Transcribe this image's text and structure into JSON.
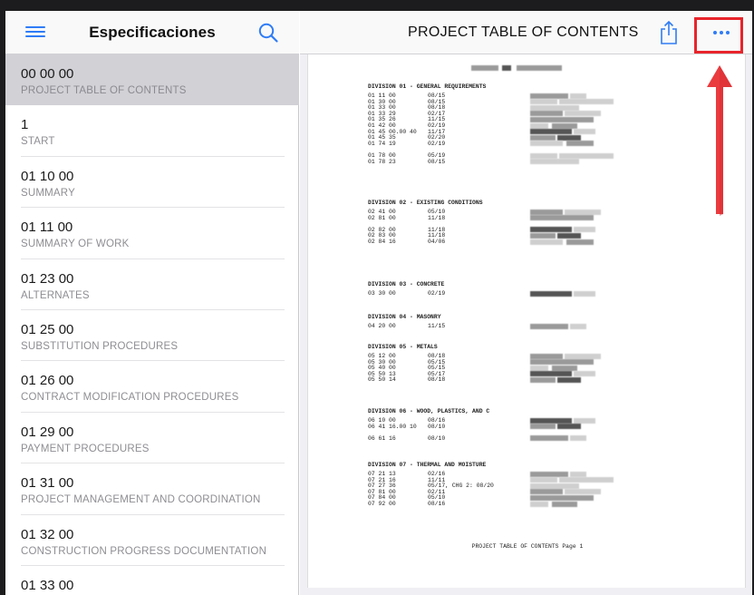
{
  "left_pane": {
    "title": "Especificaciones",
    "items": [
      {
        "num": "00 00 00",
        "title": "PROJECT TABLE OF CONTENTS",
        "selected": true
      },
      {
        "num": "1",
        "title": "Start",
        "selected": false
      },
      {
        "num": "01 10 00",
        "title": "SUMMARY",
        "selected": false
      },
      {
        "num": "01 11 00",
        "title": "SUMMARY OF WORK",
        "selected": false
      },
      {
        "num": "01 23 00",
        "title": "ALTERNATES",
        "selected": false
      },
      {
        "num": "01 25 00",
        "title": "SUBSTITUTION PROCEDURES",
        "selected": false
      },
      {
        "num": "01 26 00",
        "title": "CONTRACT MODIFICATION PROCEDURES",
        "selected": false
      },
      {
        "num": "01 29 00",
        "title": "PAYMENT PROCEDURES",
        "selected": false
      },
      {
        "num": "01 31 00",
        "title": "PROJECT MANAGEMENT AND COORDINATION",
        "selected": false
      },
      {
        "num": "01 32 00",
        "title": "CONSTRUCTION PROGRESS DOCUMENTATION",
        "selected": false
      },
      {
        "num": "01 33 00",
        "title": "",
        "selected": false
      }
    ]
  },
  "right_pane": {
    "title": "PROJECT TABLE OF CONTENTS",
    "accent_color": "#2f7cf6",
    "annotation_color": "#e8242b"
  },
  "document": {
    "divisions": [
      {
        "heading": "DIVISION 01 - GENERAL REQUIREMENTS",
        "rows": [
          {
            "sec": "01 11 00",
            "date": "08/15"
          },
          {
            "sec": "01 30 00",
            "date": "08/15"
          },
          {
            "sec": "01 33 00",
            "date": "08/18"
          },
          {
            "sec": "01 33 29",
            "date": "02/17"
          },
          {
            "sec": "01 35 26",
            "date": "11/15"
          },
          {
            "sec": "01 42 00",
            "date": "02/19"
          },
          {
            "sec": "01 45 00.00 40",
            "date": "11/17"
          },
          {
            "sec": "01 45 35",
            "date": "02/20"
          },
          {
            "sec": "01 74 19",
            "date": "02/19"
          },
          {
            "sec": "",
            "date": ""
          },
          {
            "sec": "01 78 00",
            "date": "05/19"
          },
          {
            "sec": "01 78 23",
            "date": "08/15"
          }
        ]
      },
      {
        "heading": "DIVISION 02 - EXISTING CONDITIONS",
        "rows": [
          {
            "sec": "02 41 00",
            "date": "05/10"
          },
          {
            "sec": "02 81 00",
            "date": "11/18"
          },
          {
            "sec": "",
            "date": ""
          },
          {
            "sec": "02 82 00",
            "date": "11/18"
          },
          {
            "sec": "02 83 00",
            "date": "11/18"
          },
          {
            "sec": "02 84 16",
            "date": "04/06"
          }
        ]
      },
      {
        "heading": "DIVISION 03 - CONCRETE",
        "rows": [
          {
            "sec": "03 30 00",
            "date": "02/19"
          }
        ]
      },
      {
        "heading": "DIVISION 04 - MASONRY",
        "rows": [
          {
            "sec": "04 20 00",
            "date": "11/15"
          }
        ]
      },
      {
        "heading": "DIVISION 05 - METALS",
        "rows": [
          {
            "sec": "05 12 00",
            "date": "08/18"
          },
          {
            "sec": "05 30 00",
            "date": "05/15"
          },
          {
            "sec": "05 40 00",
            "date": "05/15"
          },
          {
            "sec": "05 50 13",
            "date": "05/17"
          },
          {
            "sec": "05 50 14",
            "date": "08/18"
          }
        ]
      },
      {
        "heading": "DIVISION 06 - WOOD, PLASTICS, AND C",
        "rows": [
          {
            "sec": "06 10 00",
            "date": "08/16"
          },
          {
            "sec": "06 41 16.00 10",
            "date": "08/10"
          },
          {
            "sec": "",
            "date": ""
          },
          {
            "sec": "06 61 16",
            "date": "08/10"
          }
        ]
      },
      {
        "heading": "DIVISION 07 - THERMAL AND MOISTURE",
        "rows": [
          {
            "sec": "07 21 13",
            "date": "02/16"
          },
          {
            "sec": "07 21 16",
            "date": "11/11"
          },
          {
            "sec": "07 27 36",
            "date": "05/17, CHG 2: 08/20"
          },
          {
            "sec": "07 81 00",
            "date": "02/11"
          },
          {
            "sec": "07 84 00",
            "date": "05/10"
          },
          {
            "sec": "07 92 00",
            "date": "08/16"
          }
        ]
      }
    ],
    "footer": "PROJECT TABLE OF CONTENTS Page 1"
  }
}
